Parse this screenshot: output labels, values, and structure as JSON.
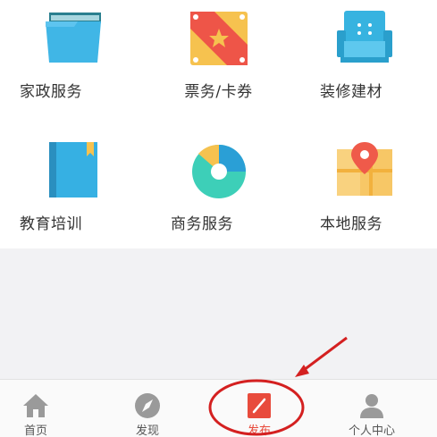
{
  "services": [
    {
      "label": "家政服务",
      "icon": "folder-icon"
    },
    {
      "label": "票务/卡券",
      "icon": "ticket-icon"
    },
    {
      "label": "装修建材",
      "icon": "sofa-icon"
    },
    {
      "label": "教育培训",
      "icon": "book-icon"
    },
    {
      "label": "商务服务",
      "icon": "pie-chart-icon"
    },
    {
      "label": "本地服务",
      "icon": "map-pin-icon"
    }
  ],
  "tabs": {
    "home": "首页",
    "discover": "发现",
    "publish": "发布",
    "profile": "个人中心"
  },
  "colors": {
    "accent": "#e84b3c",
    "annotation": "#d42020",
    "tab_icon": "#9a9a9a"
  }
}
